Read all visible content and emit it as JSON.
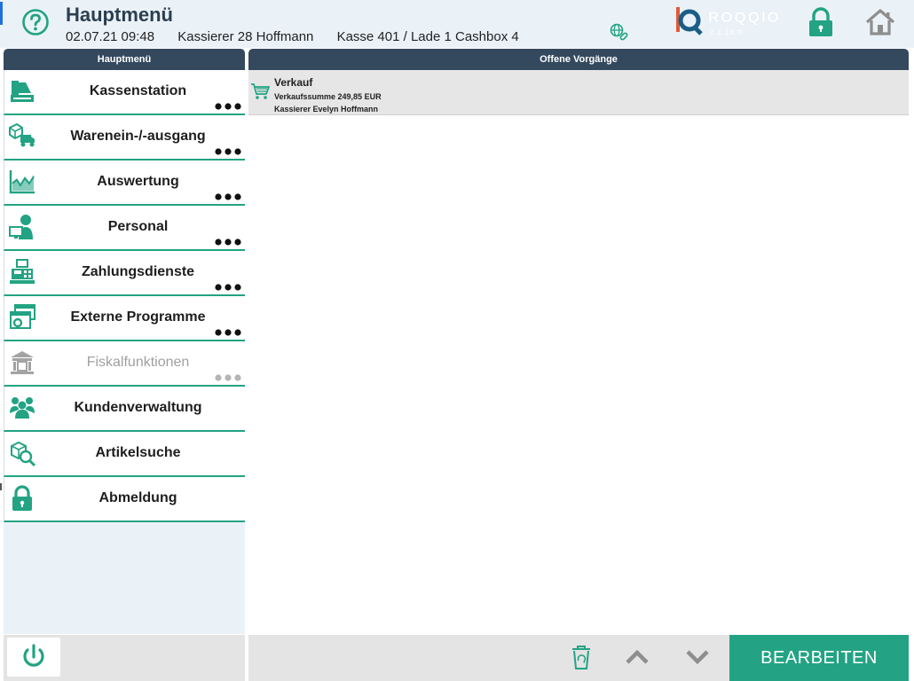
{
  "header": {
    "title": "Hauptmenü",
    "date_time": "02.07.21  09:48",
    "cashier": "Kassierer 28 Hoffmann",
    "register": "Kasse 401 / Lade 1 Cashbox 4",
    "logo_text": "ROQQIO",
    "logo_version": "2.1.14.0"
  },
  "left_panel": {
    "title": "Hauptmenü",
    "items": [
      {
        "label": "Kassenstation",
        "icon": "cash-register-icon",
        "has_more": true,
        "enabled": true
      },
      {
        "label": "Warenein-/-ausgang",
        "icon": "goods-transfer-icon",
        "has_more": true,
        "enabled": true
      },
      {
        "label": "Auswertung",
        "icon": "chart-icon",
        "has_more": true,
        "enabled": true
      },
      {
        "label": "Personal",
        "icon": "personnel-icon",
        "has_more": true,
        "enabled": true
      },
      {
        "label": "Zahlungsdienste",
        "icon": "payment-terminal-icon",
        "has_more": true,
        "enabled": true
      },
      {
        "label": "Externe Programme",
        "icon": "external-programs-icon",
        "has_more": true,
        "enabled": true
      },
      {
        "label": "Fiskalfunktionen",
        "icon": "fiscal-building-icon",
        "has_more": true,
        "enabled": false
      },
      {
        "label": "Kundenverwaltung",
        "icon": "customers-icon",
        "has_more": false,
        "enabled": true
      },
      {
        "label": "Artikelsuche",
        "icon": "article-search-icon",
        "has_more": false,
        "enabled": true
      },
      {
        "label": "Abmeldung",
        "icon": "lock-icon",
        "has_more": false,
        "enabled": true
      }
    ]
  },
  "right_panel": {
    "title": "Offene Vorgänge",
    "transactions": [
      {
        "title": "Verkauf",
        "sum": "Verkaufssumme 249,85 EUR",
        "cashier": "Kassierer Evelyn Hoffmann"
      }
    ]
  },
  "footer": {
    "edit_label": "BEARBEITEN"
  },
  "colors": {
    "accent": "#23a383",
    "panel_header": "#34495e",
    "background": "#eaf2f8"
  }
}
